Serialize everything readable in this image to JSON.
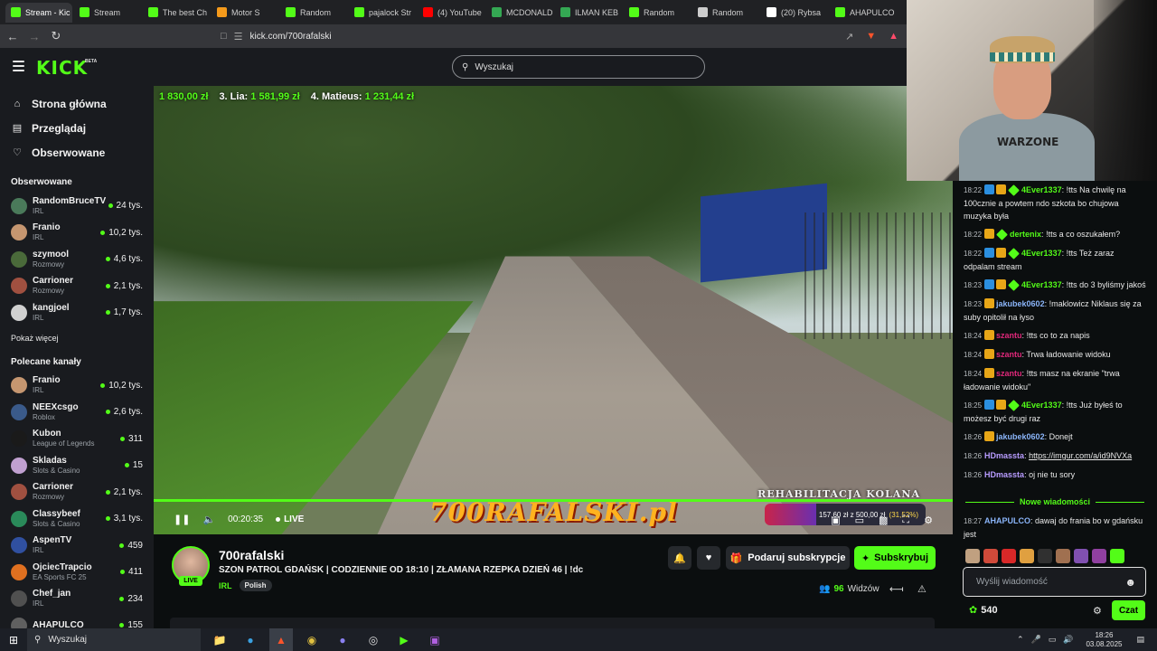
{
  "browser": {
    "tabs": [
      {
        "label": "Stream - Kic",
        "icon": "kick-favicon",
        "color": "#53fc18",
        "active": true
      },
      {
        "label": "Stream",
        "icon": "kick-favicon",
        "color": "#53fc18"
      },
      {
        "label": "The best Ch",
        "icon": "kick-favicon",
        "color": "#53fc18"
      },
      {
        "label": "Motor S",
        "icon": "blogger-favicon",
        "color": "#f59a1b"
      },
      {
        "label": "Random",
        "icon": "kick-favicon",
        "color": "#53fc18"
      },
      {
        "label": "pajalock Str",
        "icon": "kick-favicon",
        "color": "#53fc18"
      },
      {
        "label": "(4) YouTube",
        "icon": "youtube-favicon",
        "color": "#ff0000"
      },
      {
        "label": "MCDONALD",
        "icon": "maps-pin-favicon",
        "color": "#34a853"
      },
      {
        "label": "ILMAN KEB",
        "icon": "maps-pin-favicon",
        "color": "#34a853"
      },
      {
        "label": "Random",
        "icon": "kick-favicon",
        "color": "#53fc18"
      },
      {
        "label": "Random",
        "icon": "speaker-favicon",
        "color": "#cccccc"
      },
      {
        "label": "(20) Rybsa",
        "icon": "x-favicon",
        "color": "#ffffff"
      },
      {
        "label": "AHAPULCO",
        "icon": "kick-favicon",
        "color": "#53fc18"
      }
    ],
    "url": "kick.com/700rafalski"
  },
  "header": {
    "logo": "KICK",
    "beta": "BETA",
    "search_placeholder": "Wyszukaj"
  },
  "sidebar": {
    "nav": [
      {
        "label": "Strona główna",
        "icon": "home-icon"
      },
      {
        "label": "Przeglądaj",
        "icon": "browse-icon"
      },
      {
        "label": "Obserwowane",
        "icon": "heart-icon"
      }
    ],
    "following_title": "Obserwowane",
    "following": [
      {
        "name": "RandomBruceTV",
        "category": "IRL",
        "viewers": "24 tys.",
        "color": "#4a7a5a"
      },
      {
        "name": "Franio",
        "category": "IRL",
        "viewers": "10,2 tys.",
        "color": "#c59670"
      },
      {
        "name": "szymool",
        "category": "Rozmowy",
        "viewers": "4,6 tys.",
        "color": "#4a6a3a"
      },
      {
        "name": "Carrioner",
        "category": "Rozmowy",
        "viewers": "2,1 tys.",
        "color": "#a05040"
      },
      {
        "name": "kangjoel",
        "category": "IRL",
        "viewers": "1,7 tys.",
        "color": "#d0d0d0"
      }
    ],
    "show_more": "Pokaż więcej",
    "recommended_title": "Polecane kanały",
    "recommended": [
      {
        "name": "Franio",
        "category": "IRL",
        "viewers": "10,2 tys.",
        "color": "#c59670"
      },
      {
        "name": "NEEXcsgo",
        "category": "Roblox",
        "viewers": "2,6 tys.",
        "color": "#3a5a8a"
      },
      {
        "name": "Kubon",
        "category": "League of Legends",
        "viewers": "311",
        "color": "#1a1a1a"
      },
      {
        "name": "Skladas",
        "category": "Slots & Casino",
        "viewers": "15",
        "color": "#c0a0d0"
      },
      {
        "name": "Carrioner",
        "category": "Rozmowy",
        "viewers": "2,1 tys.",
        "color": "#a05040"
      },
      {
        "name": "Classybeef",
        "category": "Slots & Casino",
        "viewers": "3,1 tys.",
        "color": "#2a8a5a"
      },
      {
        "name": "AspenTV",
        "category": "IRL",
        "viewers": "459",
        "color": "#3050a0"
      },
      {
        "name": "OjciecTrapcio",
        "category": "EA Sports FC 25",
        "viewers": "411",
        "color": "#e07020"
      },
      {
        "name": "Chef_jan",
        "category": "IRL",
        "viewers": "234",
        "color": "#505050"
      },
      {
        "name": "AHAPULCO",
        "category": "",
        "viewers": "155",
        "color": "#606060"
      }
    ]
  },
  "video": {
    "leaderboard": [
      {
        "label": "",
        "amount": "1 830,00 zł"
      },
      {
        "label": "3. Lia:",
        "amount": "1 581,99 zł"
      },
      {
        "label": "4. Matieus:",
        "amount": "1 231,44 zł"
      }
    ],
    "overlay_text": "REHABILITACJA KOLANA",
    "brand_banner": "700RAFALSKI.pl",
    "goal": {
      "current": "157,60 zł",
      "sep": "z",
      "target": "500,00 zł",
      "percent": "(31,52%)",
      "fraction": 0.3152
    },
    "time": "00:20:35",
    "live_label": "LIVE"
  },
  "stream": {
    "name": "700rafalski",
    "live_badge": "LIVE",
    "title": "SZON PATROL GDAŃSK | CODZIENNIE OD 18:10 | ZŁAMANA RZEPKA DZIEŃ 46 | !dc",
    "category": "IRL",
    "tag": "Polish",
    "gift_label": "Podaruj subskrypcje",
    "subscribe_label": "Subskrybuj",
    "viewers_count": "96",
    "viewers_label": "Widzów"
  },
  "webcam": {
    "shirt_text": "WARZONE"
  },
  "chat": {
    "messages": [
      {
        "time": "18:22",
        "badges": [
          "blue",
          "gold",
          "green"
        ],
        "user": "4Ever1337",
        "color": "#53fc18",
        "text": "!tts Na chwilę na 100cznie a powtem ndo szkota bo chujowa muzyka była"
      },
      {
        "time": "18:22",
        "badges": [
          "gold",
          "green"
        ],
        "user": "dertenix",
        "color": "#53fc18",
        "text": "!tts a co oszukałem?"
      },
      {
        "time": "18:22",
        "badges": [
          "blue",
          "gold",
          "green"
        ],
        "user": "4Ever1337",
        "color": "#53fc18",
        "text": "!tts Też zaraz odpalam stream"
      },
      {
        "time": "18:23",
        "badges": [
          "blue",
          "gold",
          "green"
        ],
        "user": "4Ever1337",
        "color": "#53fc18",
        "text": "!tts do 3 byliśmy jakoś"
      },
      {
        "time": "18:23",
        "badges": [
          "gold"
        ],
        "user": "jakubek0602",
        "color": "#8ab4f8",
        "text": "!maklowicz Niklaus się za suby opitolił na łyso"
      },
      {
        "time": "18:24",
        "badges": [
          "gold"
        ],
        "user": "szantu",
        "color": "#e0287a",
        "text": "!tts co to za napis"
      },
      {
        "time": "18:24",
        "badges": [
          "gold"
        ],
        "user": "szantu",
        "color": "#e0287a",
        "text": "Trwa ładowanie widoku"
      },
      {
        "time": "18:24",
        "badges": [
          "gold"
        ],
        "user": "szantu",
        "color": "#e0287a",
        "text": "!tts masz na ekranie \"trwa ładowanie widoku\""
      },
      {
        "time": "18:25",
        "badges": [
          "blue",
          "gold",
          "green"
        ],
        "user": "4Ever1337",
        "color": "#53fc18",
        "text": "!tts Już byłeś to możesz być drugi raz"
      },
      {
        "time": "18:26",
        "badges": [
          "gold"
        ],
        "user": "jakubek0602",
        "color": "#8ab4f8",
        "text": "Donejt"
      },
      {
        "time": "18:26",
        "badges": [],
        "user": "HDmassta",
        "color": "#b89cff",
        "text": "",
        "link": "https://imgur.com/a/id9NVXa"
      },
      {
        "time": "18:26",
        "badges": [],
        "user": "HDmassta",
        "color": "#b89cff",
        "text": "oj nie tu sory"
      }
    ],
    "new_messages_label": "Nowe wiadomości",
    "last_message": {
      "time": "18:27",
      "badges": [],
      "user": "AHAPULCO",
      "color": "#8ab4f8",
      "text": "dawaj do frania bo w gdańsku jest"
    },
    "input_placeholder": "Wyślij wiadomość",
    "points": "540",
    "send_label": "Czat",
    "emote_colors": [
      "#c0a080",
      "#d04a3a",
      "#d82828",
      "#e0a040",
      "#303030",
      "#a07050",
      "#8050b0",
      "#9040a0",
      "#53fc18"
    ]
  },
  "taskbar": {
    "search_placeholder": "Wyszukaj",
    "time": "18:26",
    "date": "03.08.2025"
  },
  "colors": {
    "accent": "#53fc18",
    "bg": "#0b0e0f",
    "panel": "#191b1f"
  }
}
